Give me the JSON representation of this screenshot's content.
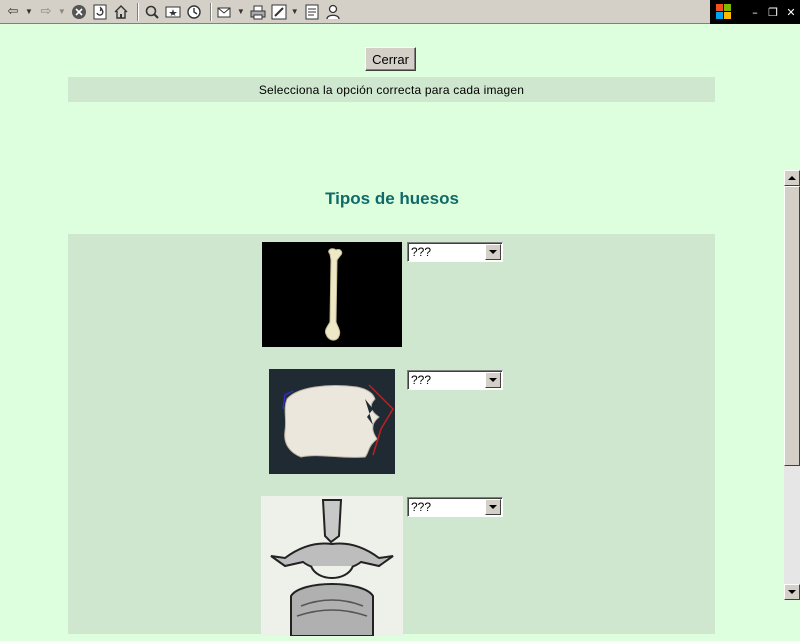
{
  "toolbar": {
    "buttons": [
      {
        "name": "back-icon",
        "glyph": "⇦"
      },
      {
        "name": "forward-icon",
        "glyph": "⇨"
      },
      {
        "name": "stop-icon",
        "glyph": "⊗"
      },
      {
        "name": "refresh-icon",
        "glyph": "⟳"
      },
      {
        "name": "home-icon",
        "glyph": "⌂"
      },
      {
        "name": "search-icon",
        "glyph": "🔍"
      },
      {
        "name": "favorites-icon",
        "glyph": "☆"
      },
      {
        "name": "history-icon",
        "glyph": "◷"
      },
      {
        "name": "mail-icon",
        "glyph": "✉"
      },
      {
        "name": "print-icon",
        "glyph": "⎙"
      },
      {
        "name": "edit-icon",
        "glyph": "✎"
      },
      {
        "name": "discuss-icon",
        "glyph": "☰"
      },
      {
        "name": "messenger-icon",
        "glyph": "☺"
      }
    ],
    "window_controls": {
      "minimize": "–",
      "restore": "❐",
      "close": "✕"
    }
  },
  "page": {
    "close_button": "Cerrar",
    "instruction": "Selecciona la opción correcta para cada imagen",
    "title": "Tipos de huesos"
  },
  "questions": [
    {
      "image": "long-bone-femur",
      "selected": "???"
    },
    {
      "image": "flat-bone-skull",
      "selected": "???"
    },
    {
      "image": "irregular-bone-vertebra",
      "selected": "???"
    }
  ],
  "colors": {
    "page_bg": "#deffde",
    "panel_bg": "#cfe6cf",
    "title_color": "#0f6a6a"
  }
}
